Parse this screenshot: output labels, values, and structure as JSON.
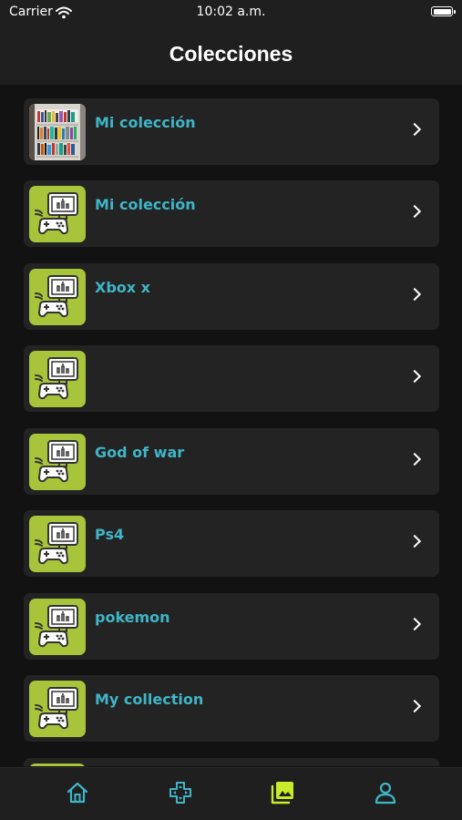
{
  "status_bar": {
    "carrier": "Carrier",
    "time": "10:02 a.m."
  },
  "header": {
    "title": "Colecciones"
  },
  "colors": {
    "accent": "#3fb5c6",
    "thumb_green": "#a8c43a",
    "active_tab": "#c6ec2b",
    "background": "#121212",
    "card": "#232323"
  },
  "collections": [
    {
      "name": "Mi colección",
      "thumbnail": "shelf-photo"
    },
    {
      "name": "Mi colección",
      "thumbnail": "console-icon"
    },
    {
      "name": "Xbox x",
      "thumbnail": "console-icon"
    },
    {
      "name": "",
      "thumbnail": "console-icon"
    },
    {
      "name": "God of war",
      "thumbnail": "console-icon"
    },
    {
      "name": "Ps4",
      "thumbnail": "console-icon"
    },
    {
      "name": "pokemon",
      "thumbnail": "console-icon"
    },
    {
      "name": "My collection",
      "thumbnail": "console-icon"
    },
    {
      "name": "",
      "thumbnail": "console-icon"
    }
  ],
  "tabs": [
    {
      "icon": "home-icon",
      "active": false
    },
    {
      "icon": "gamepad-icon",
      "active": false
    },
    {
      "icon": "collections-icon",
      "active": true
    },
    {
      "icon": "profile-icon",
      "active": false
    }
  ]
}
